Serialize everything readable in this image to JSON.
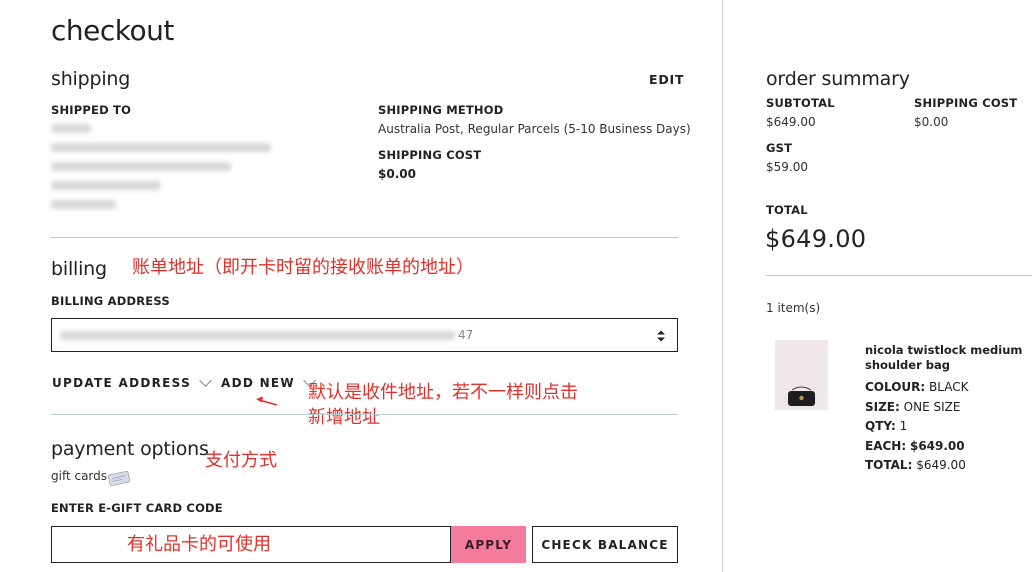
{
  "page_title": "checkout",
  "shipping": {
    "heading": "shipping",
    "edit_label": "EDIT",
    "shipped_to_label": "SHIPPED TO",
    "shipping_method_label": "SHIPPING METHOD",
    "shipping_method_value": "Australia Post, Regular Parcels (5-10 Business Days)",
    "shipping_cost_label": "SHIPPING COST",
    "shipping_cost_value": "$0.00"
  },
  "billing": {
    "heading": "billing",
    "annotation": "账单地址（即开卡时留的接收账单的地址）",
    "address_label": "BILLING ADDRESS",
    "address_tail": "47",
    "update_address_label": "UPDATE ADDRESS",
    "add_new_label": "ADD NEW",
    "add_new_annotation_line1": "默认是收件地址，若不一样则点击",
    "add_new_annotation_line2": "新增地址"
  },
  "payment": {
    "heading": "payment options",
    "annotation": "支付方式",
    "gift_cards_label": "gift cards",
    "ecard_label": "ENTER E-GIFT CARD CODE",
    "ecard_annotation": "有礼品卡的可使用",
    "apply_label": "APPLY",
    "check_balance_label": "CHECK BALANCE"
  },
  "summary": {
    "heading": "order summary",
    "subtotal_label": "SUBTOTAL",
    "subtotal_value": "$649.00",
    "shipping_cost_label": "SHIPPING COST",
    "shipping_cost_value": "$0.00",
    "gst_label": "GST",
    "gst_value": "$59.00",
    "total_label": "TOTAL",
    "total_value": "$649.00",
    "items_count": "1 item(s)",
    "item": {
      "name_line1": "nicola twistlock medium",
      "name_line2": "shoulder bag",
      "colour_label": "COLOUR:",
      "colour_value": "BLACK",
      "size_label": "SIZE:",
      "size_value": "ONE SIZE",
      "qty_label": "QTY:",
      "qty_value": "1",
      "each_label": "EACH:",
      "each_value": "$649.00",
      "total_label": "TOTAL:",
      "total_value": "$649.00"
    }
  },
  "colors": {
    "accent_pink": "#f47b9c",
    "annotation_red": "#e0302a",
    "divider": "#b9cfcf"
  }
}
